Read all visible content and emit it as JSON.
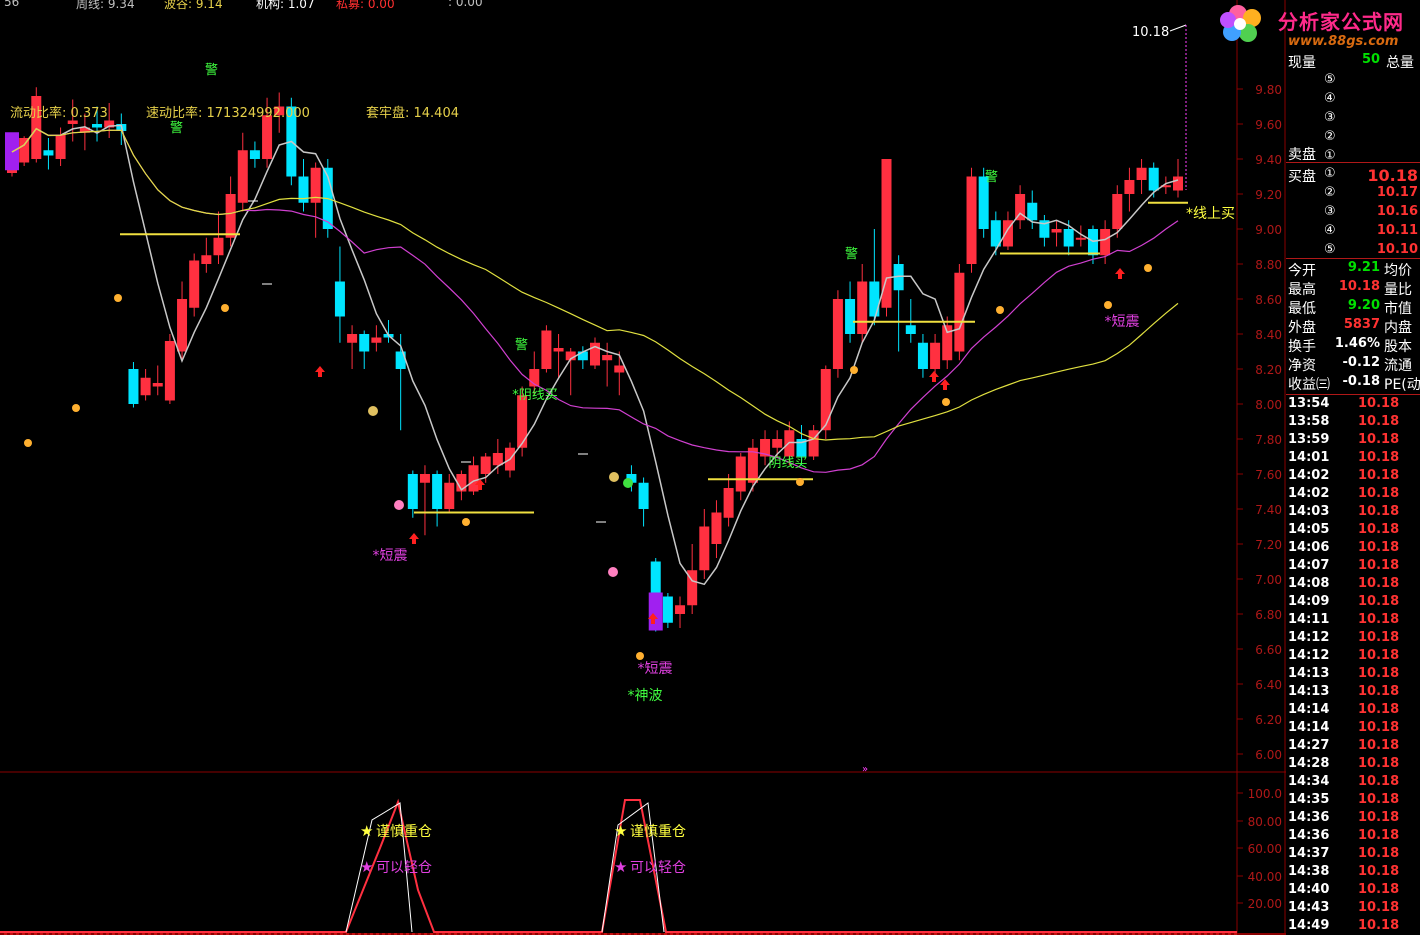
{
  "colors": {
    "up": "#ff3040",
    "down": "#00e5ff",
    "ma_fast": "#c8c8c8",
    "ma_mid": "#d040d0",
    "ma_slow": "#e0e040",
    "grid": "#8a0000",
    "axis_text": "#b01818"
  },
  "top_bar": {
    "left": "56",
    "week": "周线: 9.34",
    "wave_valley": "波谷: 9.14",
    "institution": "机构: 1.07",
    "private": "私募: 0.00",
    "extra": ": 0.00"
  },
  "ratios": {
    "liquidity": "流动比率: 0.373",
    "quick": "速动比率: 171324992.000",
    "trap": "套牢盘: 14.404"
  },
  "logo": {
    "title": "分析家公式网",
    "url": "www.88gs.com"
  },
  "price_axis": [
    "9.80",
    "9.60",
    "9.40",
    "9.20",
    "9.00",
    "8.80",
    "8.60",
    "8.40",
    "8.20",
    "8.00",
    "7.80",
    "7.60",
    "7.40",
    "7.20",
    "7.00",
    "6.80",
    "6.60",
    "6.40",
    "6.20",
    "6.00"
  ],
  "osc_axis": [
    "100.0",
    "80.00",
    "60.00",
    "40.00",
    "20.00"
  ],
  "annotations": {
    "peak_price": "10.18",
    "warn": "警",
    "short_shock": "*短震",
    "yin_buy": "*阴线买",
    "yin_buy2": "阴线买",
    "god_wave": "*神波",
    "line_buy": "*线上买",
    "caution_heavy": "谨慎重仓",
    "light_pos": "可以轻仓"
  },
  "panel": {
    "top_row": {
      "left": "现量",
      "value": "50",
      "right": "总量"
    },
    "sell_label": "卖盘",
    "buy_label": "买盘",
    "sell_levels": [
      "⑤",
      "④",
      "③",
      "②",
      "①"
    ],
    "buy_levels": [
      {
        "n": "①",
        "p": "10.18"
      },
      {
        "n": "②",
        "p": "10.17"
      },
      {
        "n": "③",
        "p": "10.16"
      },
      {
        "n": "④",
        "p": "10.11"
      },
      {
        "n": "⑤",
        "p": "10.10"
      }
    ],
    "stats": [
      {
        "l": "今开",
        "v": "9.21",
        "r": "均价",
        "c": "#00e000"
      },
      {
        "l": "最高",
        "v": "10.18",
        "r": "量比",
        "c": "#ff3232"
      },
      {
        "l": "最低",
        "v": "9.20",
        "r": "市值",
        "c": "#00e000"
      },
      {
        "l": "外盘",
        "v": "5837",
        "r": "内盘",
        "c": "#ff3232"
      },
      {
        "l": "换手",
        "v": "1.46%",
        "r": "股本",
        "c": "#ffffff"
      },
      {
        "l": "净资",
        "v": "-0.12",
        "r": "流通",
        "c": "#ffffff"
      },
      {
        "l": "收益㈢",
        "v": "-0.18",
        "r": "PE(动",
        "c": "#ffffff"
      }
    ],
    "ticks": [
      {
        "t": "13:54",
        "p": "10.18"
      },
      {
        "t": "13:58",
        "p": "10.18"
      },
      {
        "t": "13:59",
        "p": "10.18"
      },
      {
        "t": "14:01",
        "p": "10.18"
      },
      {
        "t": "14:02",
        "p": "10.18"
      },
      {
        "t": "14:02",
        "p": "10.18"
      },
      {
        "t": "14:03",
        "p": "10.18"
      },
      {
        "t": "14:05",
        "p": "10.18"
      },
      {
        "t": "14:06",
        "p": "10.18"
      },
      {
        "t": "14:07",
        "p": "10.18"
      },
      {
        "t": "14:08",
        "p": "10.18"
      },
      {
        "t": "14:09",
        "p": "10.18"
      },
      {
        "t": "14:11",
        "p": "10.18"
      },
      {
        "t": "14:12",
        "p": "10.18"
      },
      {
        "t": "14:12",
        "p": "10.18"
      },
      {
        "t": "14:13",
        "p": "10.18"
      },
      {
        "t": "14:13",
        "p": "10.18"
      },
      {
        "t": "14:14",
        "p": "10.18"
      },
      {
        "t": "14:14",
        "p": "10.18"
      },
      {
        "t": "14:27",
        "p": "10.18"
      },
      {
        "t": "14:28",
        "p": "10.18"
      },
      {
        "t": "14:34",
        "p": "10.18"
      },
      {
        "t": "14:35",
        "p": "10.18"
      },
      {
        "t": "14:36",
        "p": "10.18"
      },
      {
        "t": "14:36",
        "p": "10.18"
      },
      {
        "t": "14:37",
        "p": "10.18"
      },
      {
        "t": "14:38",
        "p": "10.18"
      },
      {
        "t": "14:40",
        "p": "10.18"
      },
      {
        "t": "14:43",
        "p": "10.18"
      },
      {
        "t": "14:49",
        "p": "10.18"
      }
    ]
  },
  "candles": [
    [
      9.32,
      9.44,
      9.35,
      9.3
    ],
    [
      9.38,
      9.52,
      9.53,
      9.36
    ],
    [
      9.4,
      9.76,
      9.81,
      9.38
    ],
    [
      9.45,
      9.42,
      9.52,
      9.34
    ],
    [
      9.4,
      9.54,
      9.58,
      9.36
    ],
    [
      9.6,
      9.62,
      9.74,
      9.5
    ],
    [
      9.55,
      9.58,
      9.66,
      9.45
    ],
    [
      9.6,
      9.58,
      9.7,
      9.5
    ],
    [
      9.58,
      9.62,
      9.72,
      9.52
    ],
    [
      9.6,
      9.56,
      9.66,
      9.48
    ],
    [
      8.2,
      8.0,
      8.24,
      7.98
    ],
    [
      8.05,
      8.15,
      8.2,
      8.02
    ],
    [
      8.1,
      8.12,
      8.22,
      8.05
    ],
    [
      8.02,
      8.36,
      8.4,
      8.0
    ],
    [
      8.3,
      8.6,
      8.7,
      8.25
    ],
    [
      8.55,
      8.82,
      8.86,
      8.5
    ],
    [
      8.8,
      8.85,
      8.95,
      8.75
    ],
    [
      8.85,
      8.95,
      9.1,
      8.8
    ],
    [
      8.95,
      9.2,
      9.3,
      8.9
    ],
    [
      9.15,
      9.45,
      9.55,
      9.1
    ],
    [
      9.45,
      9.4,
      9.5,
      9.35
    ],
    [
      9.4,
      9.65,
      9.75,
      9.35
    ],
    [
      9.65,
      9.7,
      9.78,
      9.55
    ],
    [
      9.7,
      9.3,
      9.75,
      9.25
    ],
    [
      9.3,
      9.15,
      9.4,
      9.1
    ],
    [
      9.15,
      9.35,
      9.38,
      8.95
    ],
    [
      9.35,
      9.0,
      9.4,
      8.95
    ],
    [
      8.7,
      8.5,
      8.9,
      8.35
    ],
    [
      8.35,
      8.4,
      8.45,
      8.2
    ],
    [
      8.4,
      8.3,
      8.42,
      8.2
    ],
    [
      8.35,
      8.38,
      8.45,
      8.3
    ],
    [
      8.4,
      8.38,
      8.48,
      8.35
    ],
    [
      8.3,
      8.2,
      8.4,
      7.85
    ],
    [
      7.6,
      7.4,
      7.62,
      7.35
    ],
    [
      7.55,
      7.6,
      7.65,
      7.25
    ],
    [
      7.6,
      7.4,
      7.62,
      7.3
    ],
    [
      7.4,
      7.55,
      7.6,
      7.38
    ],
    [
      7.5,
      7.6,
      7.62,
      7.45
    ],
    [
      7.5,
      7.65,
      7.7,
      7.48
    ],
    [
      7.6,
      7.7,
      7.72,
      7.55
    ],
    [
      7.65,
      7.72,
      7.8,
      7.6
    ],
    [
      7.62,
      7.75,
      7.78,
      7.58
    ],
    [
      7.75,
      8.05,
      8.1,
      7.7
    ],
    [
      8.1,
      8.2,
      8.3,
      8.05
    ],
    [
      8.2,
      8.42,
      8.45,
      8.18
    ],
    [
      8.3,
      8.32,
      8.4,
      8.15
    ],
    [
      8.25,
      8.3,
      8.32,
      8.05
    ],
    [
      8.3,
      8.25,
      8.33,
      8.2
    ],
    [
      8.22,
      8.35,
      8.38,
      8.2
    ],
    [
      8.25,
      8.28,
      8.35,
      8.1
    ],
    [
      8.18,
      8.22,
      8.3,
      8.05
    ],
    [
      7.6,
      7.55,
      7.65,
      7.5
    ],
    [
      7.55,
      7.4,
      7.58,
      7.3
    ],
    [
      7.1,
      6.9,
      7.12,
      6.7
    ],
    [
      6.9,
      6.75,
      6.92,
      6.72
    ],
    [
      6.8,
      6.85,
      6.9,
      6.72
    ],
    [
      6.85,
      7.05,
      7.2,
      6.8
    ],
    [
      7.05,
      7.3,
      7.4,
      7.0
    ],
    [
      7.2,
      7.38,
      7.45,
      7.12
    ],
    [
      7.35,
      7.52,
      7.6,
      7.3
    ],
    [
      7.5,
      7.7,
      7.72,
      7.45
    ],
    [
      7.55,
      7.75,
      7.8,
      7.5
    ],
    [
      7.7,
      7.8,
      7.85,
      7.65
    ],
    [
      7.75,
      7.8,
      7.85,
      7.7
    ],
    [
      7.7,
      7.85,
      7.9,
      7.65
    ],
    [
      7.8,
      7.7,
      7.88,
      7.65
    ],
    [
      7.7,
      7.85,
      7.88,
      7.68
    ],
    [
      7.85,
      8.2,
      8.22,
      7.8
    ],
    [
      8.2,
      8.6,
      8.65,
      8.15
    ],
    [
      8.6,
      8.4,
      8.7,
      8.35
    ],
    [
      8.4,
      8.7,
      8.8,
      8.35
    ],
    [
      8.7,
      8.5,
      9.0,
      8.45
    ],
    [
      8.55,
      9.4,
      9.4,
      8.5
    ],
    [
      8.8,
      8.65,
      8.85,
      8.3
    ],
    [
      8.45,
      8.4,
      8.6,
      8.35
    ],
    [
      8.35,
      8.2,
      8.4,
      8.15
    ],
    [
      8.2,
      8.35,
      8.4,
      8.15
    ],
    [
      8.25,
      8.45,
      8.5,
      8.2
    ],
    [
      8.3,
      8.75,
      8.8,
      8.25
    ],
    [
      8.8,
      9.3,
      9.35,
      8.75
    ],
    [
      9.3,
      9.0,
      9.35,
      8.95
    ],
    [
      9.05,
      8.9,
      9.1,
      8.85
    ],
    [
      8.9,
      9.05,
      9.1,
      8.88
    ],
    [
      9.05,
      9.2,
      9.25,
      9.0
    ],
    [
      9.15,
      9.05,
      9.22,
      9.0
    ],
    [
      9.05,
      8.95,
      9.08,
      8.9
    ],
    [
      8.98,
      9.0,
      9.05,
      8.9
    ],
    [
      9.0,
      8.9,
      9.05,
      8.85
    ],
    [
      8.95,
      8.95,
      9.02,
      8.9
    ],
    [
      9.0,
      8.85,
      9.02,
      8.8
    ],
    [
      8.85,
      9.0,
      9.05,
      8.8
    ],
    [
      9.0,
      9.2,
      9.25,
      8.95
    ],
    [
      9.2,
      9.28,
      9.35,
      9.1
    ],
    [
      9.28,
      9.35,
      9.4,
      9.2
    ],
    [
      9.35,
      9.22,
      9.38,
      9.18
    ],
    [
      9.25,
      9.25,
      9.3,
      9.2
    ],
    [
      9.22,
      9.3,
      9.4,
      9.18
    ]
  ]
}
